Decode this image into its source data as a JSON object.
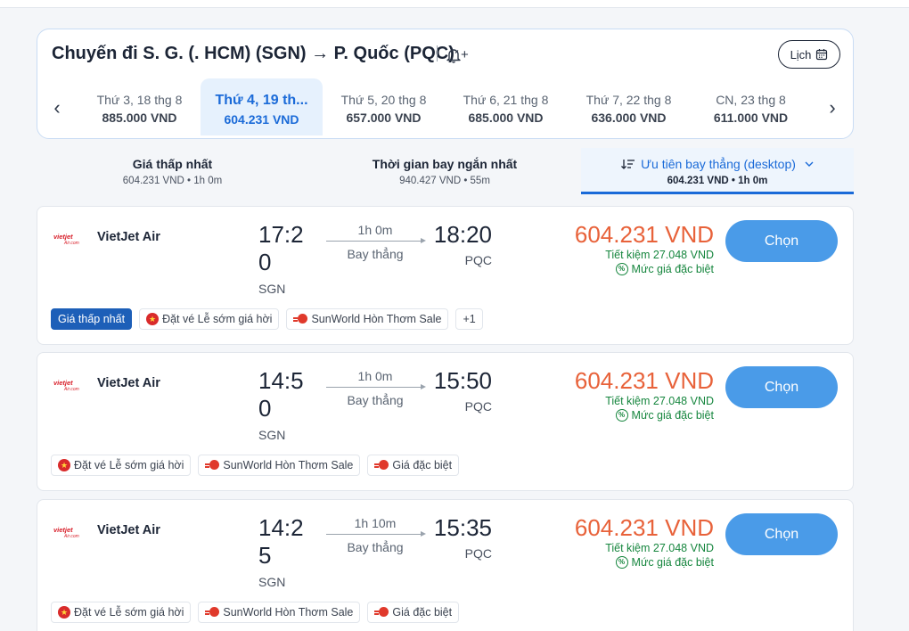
{
  "header": {
    "route_title": "Chuyến đi S. G. (. HCM) (SGN) → P. Quốc (PQC)",
    "alert_plus": "+",
    "calendar_label": "Lịch"
  },
  "date_tabs": [
    {
      "date": "Thứ 3, 18 thg 8",
      "price": "885.000 VND"
    },
    {
      "date": "Thứ 4, 19 th...",
      "price": "604.231 VND"
    },
    {
      "date": "Thứ 5, 20 thg 8",
      "price": "657.000 VND"
    },
    {
      "date": "Thứ 6, 21 thg 8",
      "price": "685.000 VND"
    },
    {
      "date": "Thứ 7, 22 thg 8",
      "price": "636.000 VND"
    },
    {
      "date": "CN, 23 thg 8",
      "price": "611.000 VND"
    }
  ],
  "sort_tabs": [
    {
      "title": "Giá thấp nhất",
      "sub": "604.231 VND • 1h 0m"
    },
    {
      "title": "Thời gian bay ngắn nhất",
      "sub": "940.427 VND • 55m"
    },
    {
      "title": "Ưu tiên bay thẳng (desktop)",
      "sub": "604.231 VND • 1h 0m"
    }
  ],
  "flights": [
    {
      "airline": "VietJet Air",
      "logo_text": "vietjet",
      "dep_time": "17:20",
      "dep_code": "SGN",
      "duration": "1h 0m",
      "stops": "Bay thẳng",
      "arr_time": "18:20",
      "arr_code": "PQC",
      "price": "604.231 VND",
      "savings": "Tiết kiệm 27.048 VND",
      "special": "Mức giá đặc biệt",
      "button": "Chọn",
      "badges": [
        "Giá thấp nhất",
        "Đặt vé Lễ sớm giá hời",
        "SunWorld Hòn Thơm Sale",
        "+1"
      ]
    },
    {
      "airline": "VietJet Air",
      "logo_text": "vietjet",
      "dep_time": "14:50",
      "dep_code": "SGN",
      "duration": "1h 0m",
      "stops": "Bay thẳng",
      "arr_time": "15:50",
      "arr_code": "PQC",
      "price": "604.231 VND",
      "savings": "Tiết kiệm 27.048 VND",
      "special": "Mức giá đặc biệt",
      "button": "Chọn",
      "badges": [
        "Đặt vé Lễ sớm giá hời",
        "SunWorld Hòn Thơm Sale",
        "Giá đặc biệt"
      ]
    },
    {
      "airline": "VietJet Air",
      "logo_text": "vietjet",
      "dep_time": "14:25",
      "dep_code": "SGN",
      "duration": "1h 10m",
      "stops": "Bay thẳng",
      "arr_time": "15:35",
      "arr_code": "PQC",
      "price": "604.231 VND",
      "savings": "Tiết kiệm 27.048 VND",
      "special": "Mức giá đặc biệt",
      "button": "Chọn",
      "badges": [
        "Đặt vé Lễ sớm giá hời",
        "SunWorld Hòn Thơm Sale",
        "Giá đặc biệt"
      ]
    }
  ],
  "colors": {
    "accent": "#1a6ad8",
    "price": "#e8623a",
    "button": "#4a9be8",
    "savings": "#16863e"
  }
}
